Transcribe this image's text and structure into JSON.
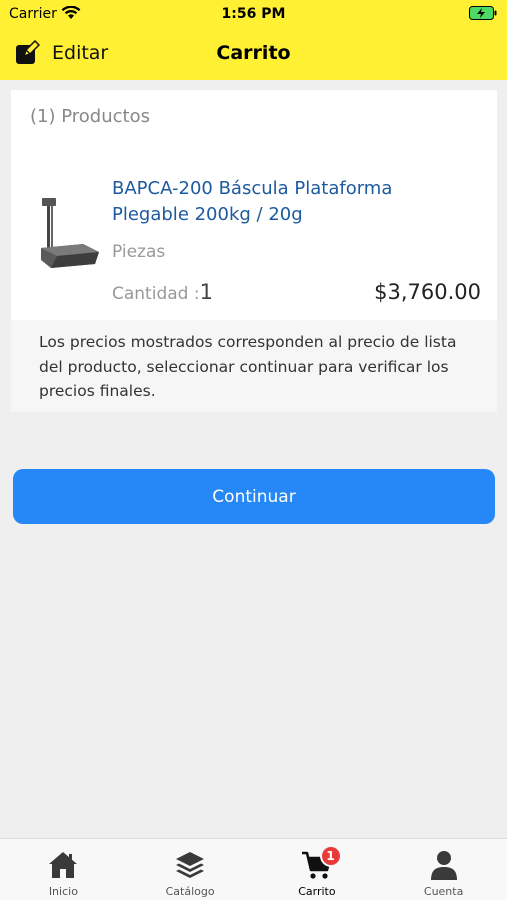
{
  "status_bar": {
    "carrier": "Carrier",
    "time": "1:56 PM"
  },
  "navbar": {
    "edit_label": "Editar",
    "title": "Carrito"
  },
  "cart": {
    "header": "(1) Productos",
    "item": {
      "name": "BAPCA-200 Báscula Plataforma Plegable 200kg / 20g",
      "unit": "Piezas",
      "quantity_label": "Cantidad :",
      "quantity": "1",
      "price": "$3,760.00"
    },
    "notice": "Los precios mostrados corresponden al precio de lista del producto, seleccionar continuar para verificar los precios finales."
  },
  "continue_label": "Continuar",
  "tabbar": {
    "tabs": [
      {
        "label": "Inicio",
        "icon": "home-icon"
      },
      {
        "label": "Catálogo",
        "icon": "layers-icon"
      },
      {
        "label": "Carrito",
        "icon": "cart-icon",
        "badge": "1",
        "active": true
      },
      {
        "label": "Cuenta",
        "icon": "user-icon"
      }
    ]
  },
  "colors": {
    "header_bg": "#fff033",
    "accent_blue": "#2588f6",
    "product_name": "#1e5aa0",
    "badge": "#e83a3a"
  }
}
